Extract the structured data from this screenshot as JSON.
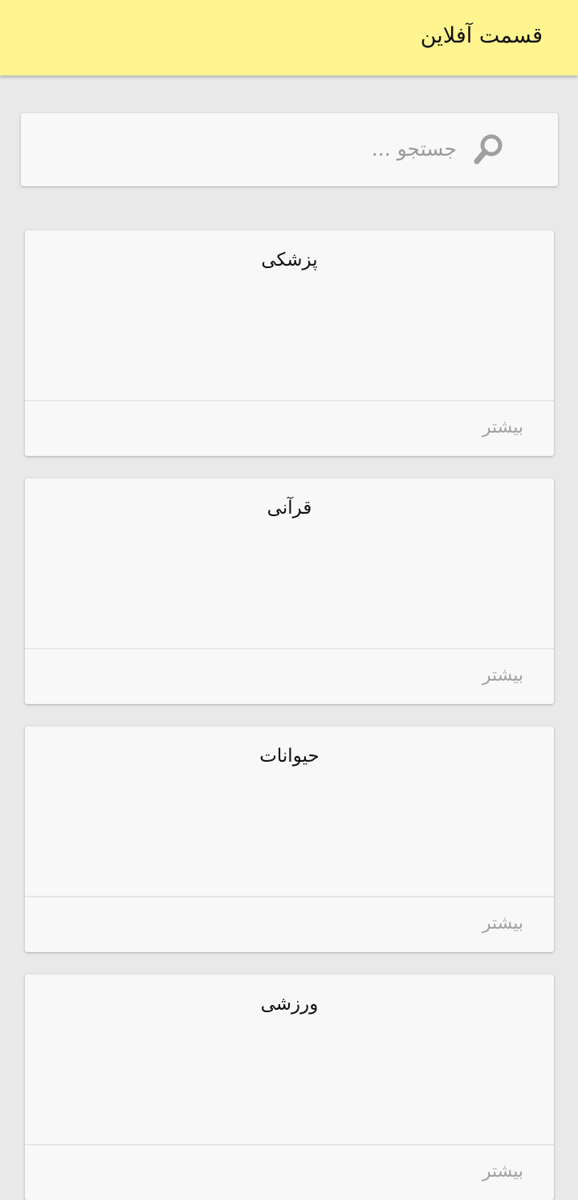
{
  "appbar": {
    "title": "قسمت آفلاین"
  },
  "search": {
    "placeholder": "جستجو ..."
  },
  "categories": [
    {
      "title": "پزشکی",
      "more_label": "بیشتر"
    },
    {
      "title": "قرآنی",
      "more_label": "بیشتر"
    },
    {
      "title": "حیوانات",
      "more_label": "بیشتر"
    },
    {
      "title": "ورزشی",
      "more_label": "بیشتر"
    }
  ],
  "colors": {
    "appbar_bg": "#fff48e",
    "page_bg": "#e9e9e9",
    "card_bg": "#f8f8f8"
  },
  "icons": {
    "search": "search-icon"
  }
}
